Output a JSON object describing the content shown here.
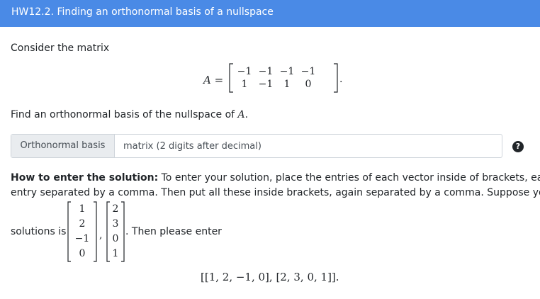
{
  "header": {
    "title": "HW12.2. Finding an orthonormal basis of a nullspace"
  },
  "question": {
    "intro": "Consider the matrix",
    "matrix_label": "A =",
    "matrix_rows": [
      [
        "−1",
        "−1",
        "−1",
        "−1"
      ],
      [
        "1",
        "−1",
        "1",
        "0"
      ]
    ],
    "matrix_end": ".",
    "prompt_prefix": "Find an orthonormal basis of the nullspace of",
    "prompt_var": "A",
    "prompt_suffix": "."
  },
  "answer": {
    "label": "Orthonormal basis",
    "placeholder": "matrix (2 digits after decimal)",
    "value": "",
    "help_icon": "question-circle-icon"
  },
  "instructions": {
    "bold": "How to enter the solution:",
    "line1_rest": " To enter your solution, place the entries of each vector inside of brackets, each",
    "line2": "entry separated by a comma. Then put all these inside brackets, again separated by a comma. Suppose your",
    "solutions_is": "solutions is",
    "vector1": [
      "1",
      "2",
      "−1",
      "0"
    ],
    "vector2": [
      "2",
      "3",
      "0",
      "1"
    ],
    "separator": ",",
    "then_enter": ". Then please enter",
    "example": "[[1, 2, −1, 0], [2, 3, 0, 1]]."
  }
}
